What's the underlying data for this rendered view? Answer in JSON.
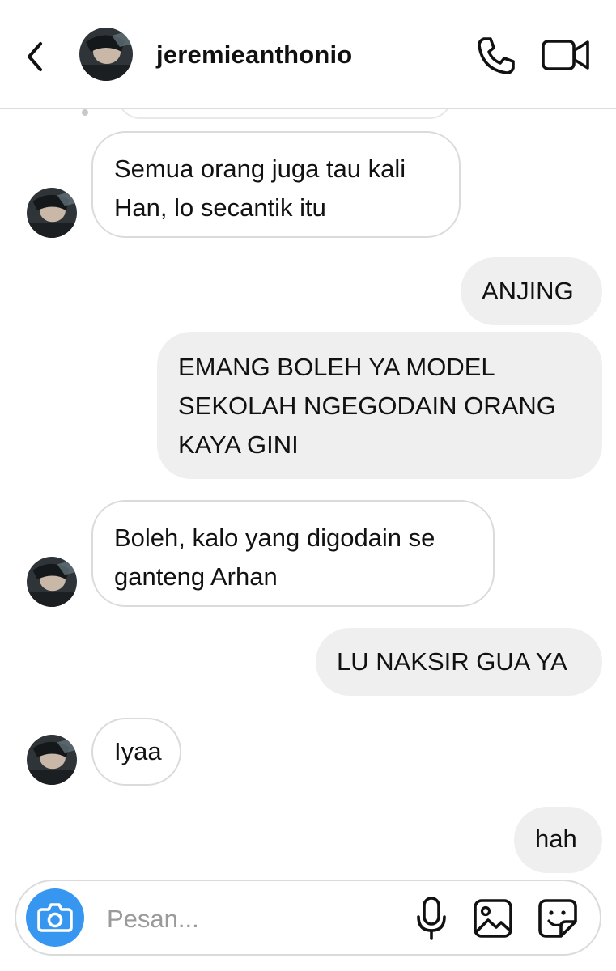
{
  "header": {
    "username": "jeremieanthonio",
    "icons": [
      "chevron-left-icon",
      "avatar",
      "phone-icon",
      "video-camera-icon"
    ]
  },
  "messages": [
    {
      "direction": "incoming",
      "text_lines": [
        "Semua orang juga tau kali",
        "Han, lo secantik itu"
      ]
    },
    {
      "direction": "outgoing",
      "text_lines": [
        "ANJING"
      ]
    },
    {
      "direction": "outgoing",
      "text_lines": [
        "EMANG BOLEH YA MODEL",
        "SEKOLAH NGEGODAIN ORANG",
        "KAYA GINI"
      ]
    },
    {
      "direction": "incoming",
      "text_lines": [
        "Boleh, kalo yang digodain se",
        "ganteng Arhan"
      ]
    },
    {
      "direction": "outgoing",
      "text_lines": [
        "LU NAKSIR GUA YA"
      ]
    },
    {
      "direction": "incoming",
      "text_lines": [
        "Iyaa"
      ]
    },
    {
      "direction": "outgoing",
      "text_lines": [
        "hah"
      ]
    }
  ],
  "composer": {
    "placeholder": "Pesan...",
    "value": "",
    "icons": [
      "camera-icon",
      "microphone-icon",
      "gallery-icon",
      "sticker-icon"
    ]
  },
  "colors": {
    "accent": "#3797f0",
    "incoming_border": "#dbdbdb",
    "outgoing_bg": "#efefef",
    "placeholder": "#9a9a9a"
  }
}
